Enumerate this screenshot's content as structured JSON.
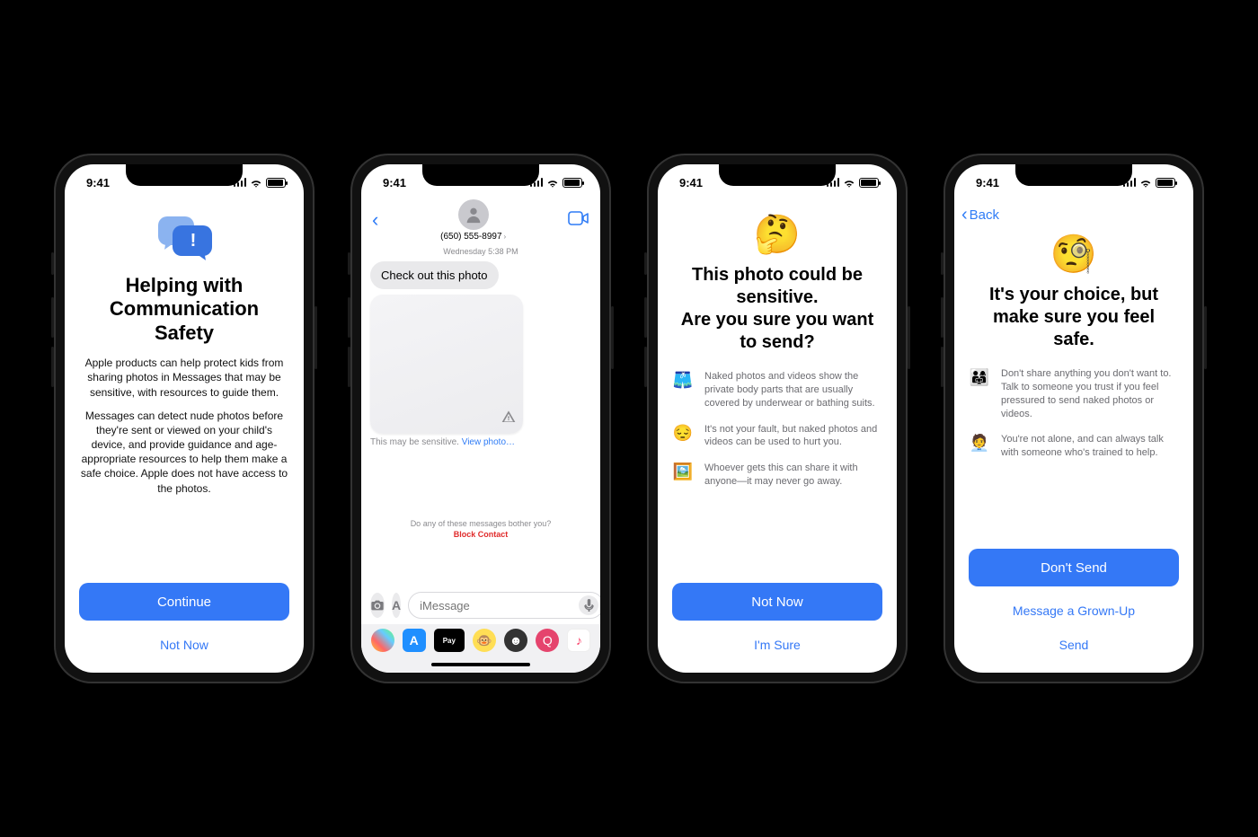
{
  "status": {
    "time": "9:41"
  },
  "screen1": {
    "title": "Helping with Communication Safety",
    "para1": "Apple products can help protect kids from sharing photos in Messages that may be sensitive, with resources to guide them.",
    "para2": "Messages can detect nude photos before they're sent or viewed on your child's device, and provide guidance and age-appropriate resources to help them make a safe choice. Apple does not have access to the photos.",
    "continue": "Continue",
    "not_now": "Not Now"
  },
  "screen2": {
    "phone": "(650) 555-8997",
    "timestamp": "Wednesday 5:38 PM",
    "msg1": "Check out this photo",
    "sensitive_prefix": "This may be sensitive. ",
    "view_photo": "View photo…",
    "bother_q": "Do any of these messages bother you?",
    "block": "Block Contact",
    "placeholder": "iMessage"
  },
  "screen3": {
    "emoji": "🤔",
    "title": "This photo could be sensitive.\nAre you sure you want to send?",
    "rows": [
      {
        "icon": "🩳",
        "text": "Naked photos and videos show the private body parts that are usually covered by underwear or bathing suits."
      },
      {
        "icon": "😔",
        "text": "It's not your fault, but naked photos and videos can be used to hurt you."
      },
      {
        "icon": "🖼️",
        "text": "Whoever gets this can share it with anyone—it may never go away."
      }
    ],
    "primary": "Not Now",
    "secondary": "I'm Sure"
  },
  "screen4": {
    "back": "Back",
    "emoji": "🧐",
    "title": "It's your choice, but make sure you feel safe.",
    "rows": [
      {
        "icon": "👨‍👩‍👧",
        "text": "Don't share anything you don't want to. Talk to someone you trust if you feel pressured to send naked photos or videos."
      },
      {
        "icon": "🧑‍💼",
        "text": "You're not alone, and can always talk with someone who's trained to help."
      }
    ],
    "primary": "Don't Send",
    "secondary1": "Message a Grown-Up",
    "secondary2": "Send"
  }
}
